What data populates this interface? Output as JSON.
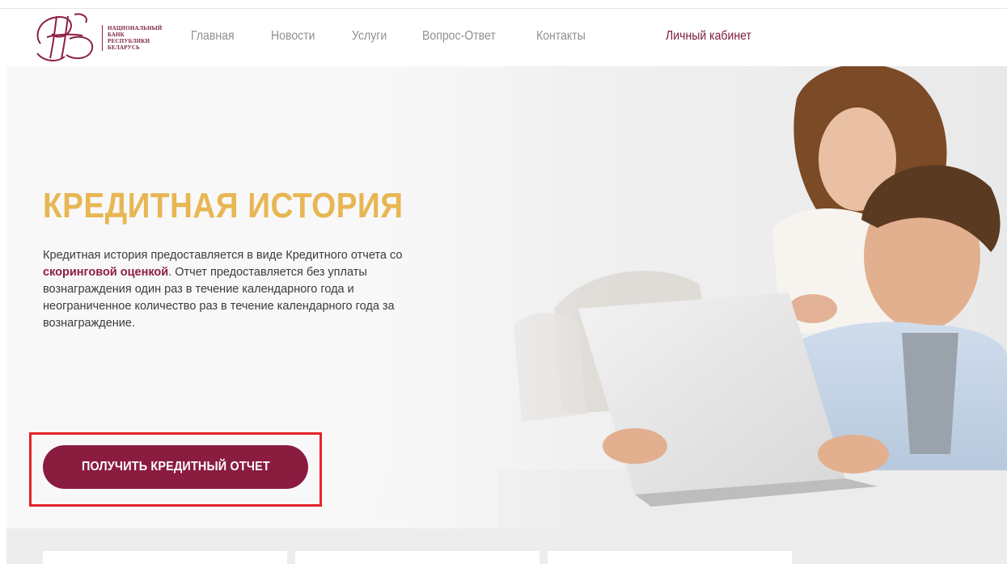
{
  "header": {
    "logo_lines": [
      "НАЦИОНАЛЬНЫЙ",
      "БАНК",
      "РЕСПУБЛИКИ",
      "БЕЛАРУСЬ"
    ],
    "nav": [
      "Главная",
      "Новости",
      "Услуги",
      "Вопрос-Ответ",
      "Контакты"
    ],
    "cabinet": "Личный кабинет"
  },
  "hero": {
    "title": "КРЕДИТНАЯ ИСТОРИЯ",
    "text_before": "Кредитная история предоставляется в виде Кредитного отчета со ",
    "text_link": "скоринговой оценкой",
    "text_after": ". Отчет предоставляется без уплаты вознаграждения один раз в течение календарного года и неограниченное количество раз в течение календарного года за вознаграждение.",
    "cta": "ПОЛУЧИТЬ КРЕДИТНЫЙ ОТЧЕТ"
  },
  "colors": {
    "brand": "#8a1c40",
    "title": "#e8b653",
    "highlight_frame": "#e3242b"
  },
  "icons": {
    "logo": "nbrb-monogram-logo"
  }
}
